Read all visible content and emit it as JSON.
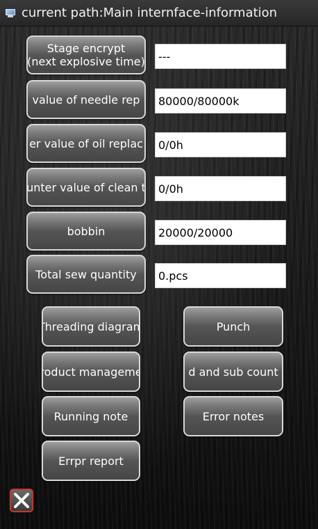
{
  "window": {
    "title": "current path:Main internface-information",
    "title_icon": "monitor-icon"
  },
  "info_rows": [
    {
      "label_line1": "Stage encrypt",
      "label_line2": "(next explosive time)",
      "value": "---"
    },
    {
      "label": "value of needle rep",
      "value": "80000/80000k"
    },
    {
      "label": "er value of oil replac",
      "value": "0/0h"
    },
    {
      "label": "unter value of clean t",
      "value": "0/0h"
    },
    {
      "label": "bobbin",
      "value": "20000/20000"
    },
    {
      "label": "Total sew quantity",
      "value": "0.pcs"
    }
  ],
  "action_buttons": {
    "threading_diagram": "Threading diagram",
    "punch": "Punch",
    "product_management": "roduct manageme",
    "add_sub_count": "d and sub count",
    "running_note": "Running note",
    "error_notes": "Error notes",
    "error_report": "Errpr report"
  },
  "close_icon": "close-icon",
  "colors": {
    "close_border": "#c9352b",
    "button_border": "#d8d8d8",
    "field_bg": "#ffffff"
  }
}
